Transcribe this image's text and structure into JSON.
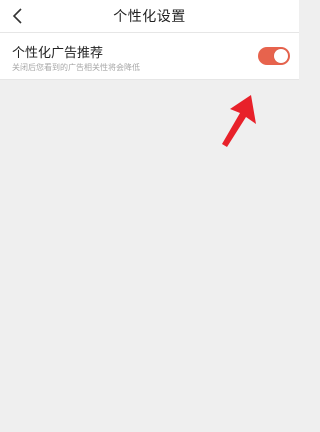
{
  "header": {
    "title": "个性化设置"
  },
  "setting": {
    "label": "个性化广告推荐",
    "description": "关闭后您看到的广告相关性将会降低",
    "enabled": true
  },
  "colors": {
    "toggle_on": "#e7634d",
    "arrow": "#e8212a",
    "background": "#efefef"
  }
}
